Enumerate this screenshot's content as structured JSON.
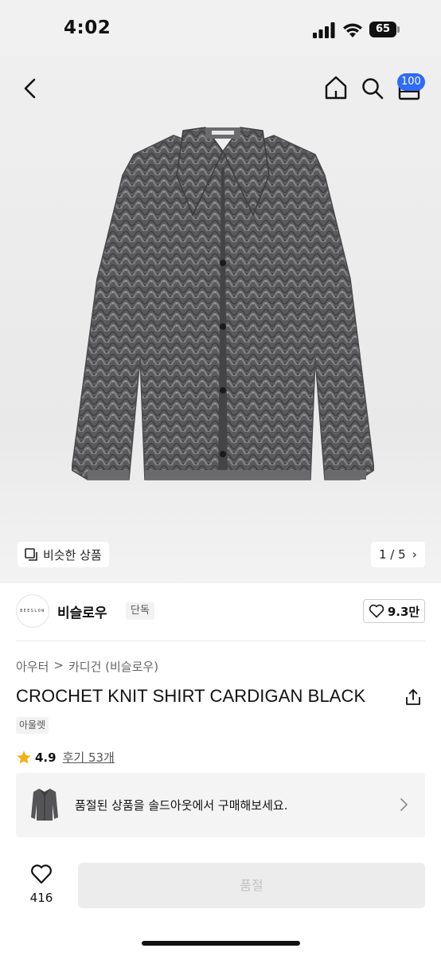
{
  "status_bar": {
    "time": "4:02",
    "battery": "65"
  },
  "header": {
    "cart_count": "100"
  },
  "gallery": {
    "similar_label": "비슷한 상품",
    "pager": "1 / 5",
    "pager_chevron": "›"
  },
  "brand": {
    "logo_text": "BEESLOW",
    "name": "비슬로우",
    "tag": "단독",
    "likes": "9.3만"
  },
  "breadcrumb": {
    "category": "아우터",
    "separator": ">",
    "subcategory": "카디건 (비슬로우)"
  },
  "product": {
    "title": "CROCHET KNIT SHIRT CARDIGAN BLACK",
    "tag": "아울렛"
  },
  "rating": {
    "score": "4.9",
    "reviews": "후기 53개"
  },
  "soldout_banner": {
    "text": "품절된 상품을 솔드아웃에서 구매해보세요."
  },
  "bottom_bar": {
    "wish_count": "416",
    "buy_label": "품절"
  },
  "colors": {
    "accent_blue": "#2e6cf6",
    "star": "#f5b014"
  },
  "icons": [
    "back-icon",
    "home-icon",
    "search-icon",
    "cart-icon",
    "similar-icon",
    "heart-icon",
    "share-icon",
    "star-icon",
    "chevron-right-icon"
  ]
}
